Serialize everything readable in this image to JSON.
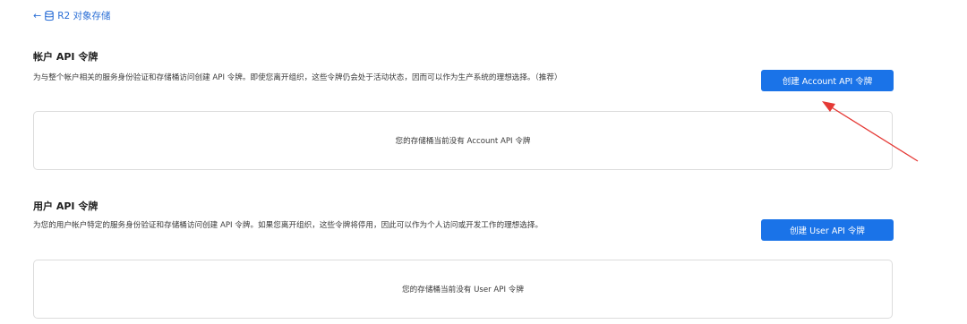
{
  "nav": {
    "back_arrow": "←",
    "back_label": "R2 对象存储",
    "icon": "database-icon"
  },
  "account_section": {
    "title": "帐户 API 令牌",
    "description": "为与整个帐户相关的服务身份验证和存储桶访问创建 API 令牌。即使您离开组织，这些令牌仍会处于活动状态，因而可以作为生产系统的理想选择。（推荐）",
    "button_label": "创建 Account API 令牌",
    "empty_message": "您的存储桶当前没有 Account API 令牌"
  },
  "user_section": {
    "title": "用户 API 令牌",
    "description": "为您的用户帐户特定的服务身份验证和存储桶访问创建 API 令牌。如果您离开组织，这些令牌将停用，因此可以作为个人访问或开发工作的理想选择。",
    "button_label": "创建 User API 令牌",
    "empty_message": "您的存储桶当前没有 User API 令牌"
  },
  "colors": {
    "accent": "#1a73e8",
    "annotation": "#e53935",
    "link": "#2b6fd6"
  }
}
